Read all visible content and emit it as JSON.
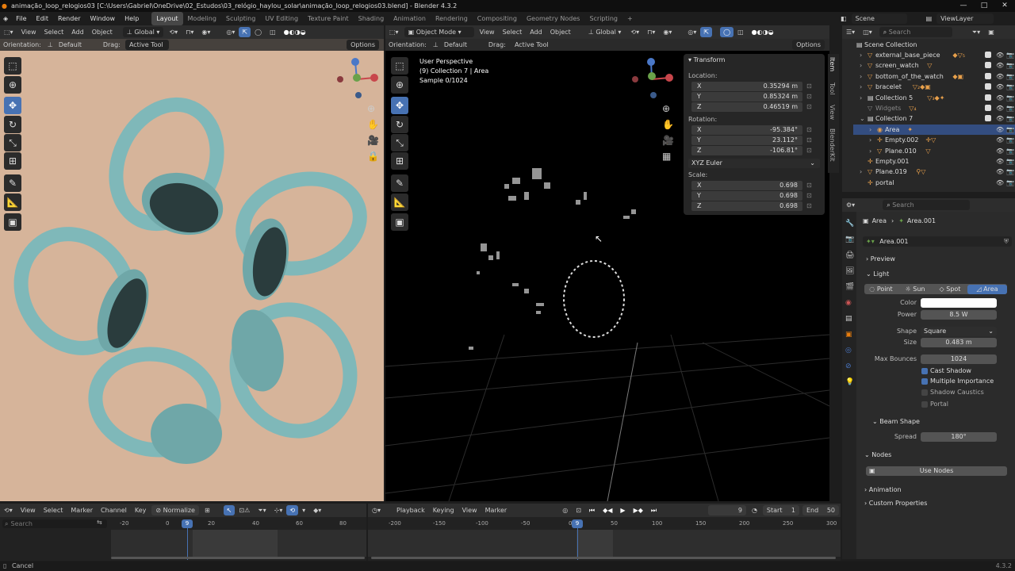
{
  "window": {
    "title": "animação_loop_relogios03 [C:\\Users\\Gabriel\\OneDrive\\02_Estudos\\03_relógio_haylou_solar\\animação_loop_relogios03.blend] - Blender 4.3.2",
    "controls": [
      "—",
      "□",
      "✕"
    ]
  },
  "menu": [
    "File",
    "Edit",
    "Render",
    "Window",
    "Help"
  ],
  "workspaces": [
    "Layout",
    "Modeling",
    "Sculpting",
    "UV Editing",
    "Texture Paint",
    "Shading",
    "Animation",
    "Rendering",
    "Compositing",
    "Geometry Nodes",
    "Scripting",
    "+"
  ],
  "scene": {
    "name": "Scene",
    "viewlayer": "ViewLayer"
  },
  "left_view": {
    "header": [
      "View",
      "Select",
      "Add",
      "Object"
    ],
    "orientation_label": "Global",
    "tool_orientation": "Orientation:",
    "tool_orientation_val": "Default",
    "drag_label": "Drag:",
    "drag_val": "Active Tool",
    "options": "Options"
  },
  "right_view": {
    "mode": "Object Mode",
    "header": [
      "View",
      "Select",
      "Add",
      "Object"
    ],
    "orientation_label": "Global",
    "tool_orientation": "Orientation:",
    "tool_orientation_val": "Default",
    "drag_label": "Drag:",
    "drag_val": "Active Tool",
    "options": "Options",
    "info": [
      "User Perspective",
      "(9) Collection 7 | Area",
      "Sample 0/1024"
    ],
    "side_tabs": [
      "Item",
      "Tool",
      "View",
      "BlenderKit"
    ]
  },
  "transform": {
    "title": "Transform",
    "location_label": "Location:",
    "location": [
      {
        "k": "X",
        "v": "0.35294 m"
      },
      {
        "k": "Y",
        "v": "0.85324 m"
      },
      {
        "k": "Z",
        "v": "0.46519 m"
      }
    ],
    "rotation_label": "Rotation:",
    "rotation": [
      {
        "k": "X",
        "v": "-95.384°"
      },
      {
        "k": "Y",
        "v": "23.112°"
      },
      {
        "k": "Z",
        "v": "-106.81°"
      }
    ],
    "rotation_mode": "XYZ Euler",
    "scale_label": "Scale:",
    "scale": [
      {
        "k": "X",
        "v": "0.698"
      },
      {
        "k": "Y",
        "v": "0.698"
      },
      {
        "k": "Z",
        "v": "0.698"
      }
    ]
  },
  "outliner": {
    "search_placeholder": "Search",
    "root": "Scene Collection",
    "items": [
      {
        "name": "external_base_piece",
        "indent": 1
      },
      {
        "name": "screen_watch",
        "indent": 1
      },
      {
        "name": "bottom_of_the_watch",
        "indent": 1
      },
      {
        "name": "bracelet",
        "indent": 1
      },
      {
        "name": "Collection 5",
        "indent": 1
      },
      {
        "name": "Widgets",
        "indent": 1
      },
      {
        "name": "Collection 7",
        "indent": 1
      },
      {
        "name": "Area",
        "indent": 2
      },
      {
        "name": "Empty.002",
        "indent": 2
      },
      {
        "name": "Plane.010",
        "indent": 2
      },
      {
        "name": "Empty.001",
        "indent": 1
      },
      {
        "name": "Plane.019",
        "indent": 1
      },
      {
        "name": "portal",
        "indent": 1
      }
    ]
  },
  "properties": {
    "search_placeholder": "Search",
    "breadcrumb": [
      "Area",
      "Area.001"
    ],
    "datablock": "Area.001",
    "preview": "Preview",
    "light": "Light",
    "light_types": [
      "Point",
      "Sun",
      "Spot",
      "Area"
    ],
    "color_label": "Color",
    "power_label": "Power",
    "power": "8.5 W",
    "shape_label": "Shape",
    "shape": "Square",
    "size_label": "Size",
    "size": "0.483 m",
    "max_bounces_label": "Max Bounces",
    "max_bounces": "1024",
    "checks": [
      {
        "label": "Cast Shadow",
        "on": true
      },
      {
        "label": "Multiple Importance",
        "on": true
      },
      {
        "label": "Shadow Caustics",
        "on": false
      },
      {
        "label": "Portal",
        "on": false
      }
    ],
    "beam_shape": "Beam Shape",
    "spread_label": "Spread",
    "spread": "180°",
    "nodes": "Nodes",
    "use_nodes": "Use Nodes",
    "animation": "Animation",
    "custom_props": "Custom Properties"
  },
  "timeline_left": {
    "header": [
      "View",
      "Select",
      "Marker",
      "Channel",
      "Key"
    ],
    "normalize": "Normalize",
    "search_placeholder": "Search",
    "ticks": [
      "-20",
      "0",
      "20",
      "40",
      "60",
      "80"
    ],
    "current": "9"
  },
  "timeline_right": {
    "header": [
      "Playback",
      "Keying",
      "View",
      "Marker"
    ],
    "frame": "9",
    "start_label": "Start",
    "start": "1",
    "end_label": "End",
    "end": "50",
    "ticks": [
      "-200",
      "-150",
      "-100",
      "-50",
      "0",
      "50",
      "100",
      "150",
      "200",
      "250",
      "300"
    ],
    "current": "9"
  },
  "status": {
    "left": "Cancel",
    "right": "4.3.2"
  },
  "colors": {
    "accent": "#4772b3",
    "left_bg": "#d6b49a",
    "watch": "#7fb8b9",
    "x_axis": "#c8464b",
    "y_axis": "#6aa14a",
    "z_axis": "#4a78c8"
  }
}
